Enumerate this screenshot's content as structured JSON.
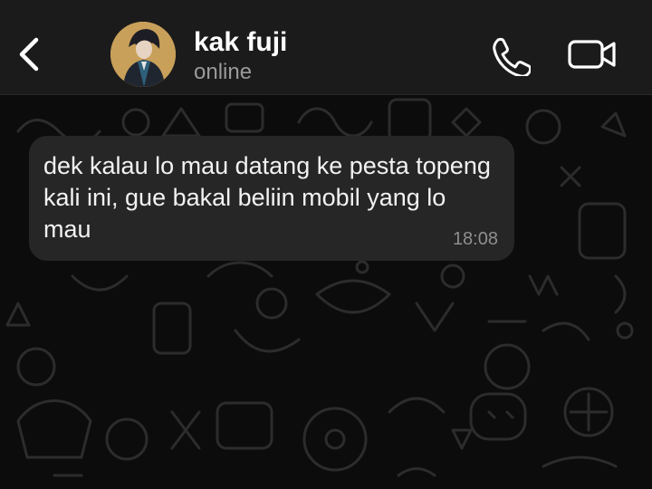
{
  "header": {
    "contact_name": "kak fuji",
    "status": "online",
    "back_icon": "chevron-left-icon",
    "call_icon": "phone-icon",
    "video_icon": "video-camera-icon",
    "avatar": "avatar"
  },
  "messages": [
    {
      "direction": "incoming",
      "text": "dek kalau lo mau datang ke pesta topeng kali ini, gue bakal beliin mobil yang lo mau",
      "time": "18:08"
    }
  ],
  "colors": {
    "header_bg": "#1b1b1b",
    "chat_bg": "#0c0c0c",
    "bubble_bg": "#262626",
    "text_primary": "#ffffff",
    "text_secondary": "#9a9a9a"
  }
}
